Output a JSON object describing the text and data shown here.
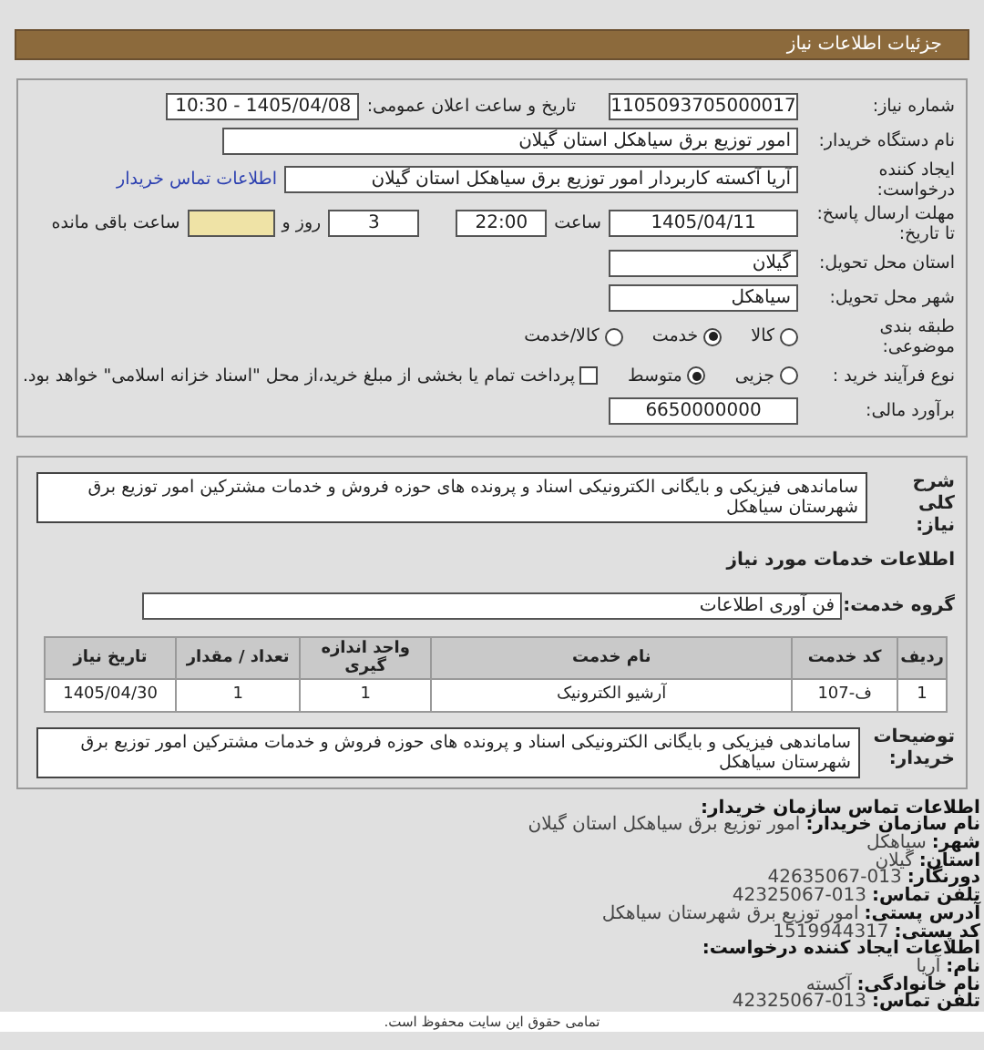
{
  "header": {
    "title": "جزئیات اطلاعات نیاز"
  },
  "need_number": {
    "label": "شماره نیاز:",
    "value": "1105093705000017"
  },
  "announce": {
    "label": "تاریخ و ساعت اعلان عمومی:",
    "value": "1405/04/08 - 10:30"
  },
  "buyer": {
    "label": "نام دستگاه خریدار:",
    "value": "امور توزیع برق سیاهکل استان گیلان"
  },
  "creator": {
    "label": "ایجاد کننده درخواست:",
    "value": "آریا آکسته کاربردار امور توزیع برق سیاهکل استان گیلان",
    "link": "اطلاعات تماس خریدار"
  },
  "deadline": {
    "label": "مهلت ارسال پاسخ: تا تاریخ:",
    "date": "1405/04/11",
    "time_label": "ساعت",
    "time": "22:00",
    "days": "3",
    "days_label": "روز و",
    "remaining_label": "ساعت باقی مانده"
  },
  "province": {
    "label": "استان محل تحویل:",
    "value": "گیلان"
  },
  "city": {
    "label": "شهر محل تحویل:",
    "value": "سیاهکل"
  },
  "category": {
    "label": "طبقه بندی موضوعی:",
    "options": [
      {
        "label": "کالا",
        "selected": false
      },
      {
        "label": "خدمت",
        "selected": true
      },
      {
        "label": "کالا/خدمت",
        "selected": false
      }
    ]
  },
  "process": {
    "label": "نوع فرآیند خرید :",
    "options": [
      {
        "label": "جزیی",
        "selected": false
      },
      {
        "label": "متوسط",
        "selected": true
      }
    ],
    "treasury": {
      "checked": false,
      "text": "پرداخت تمام یا بخشی از مبلغ خرید،از محل \"اسناد خزانه اسلامی\" خواهد بود."
    }
  },
  "estimate": {
    "label": "برآورد مالی:",
    "value": "6650000000"
  },
  "description": {
    "label": "شرح کلی نیاز:",
    "value": "ساماندهی فیزیکی و بایگانی الکترونیکی اسناد و پرونده های حوزه فروش و خدمات مشترکین امور توزیع برق شهرستان سیاهکل"
  },
  "services_heading": "اطلاعات خدمات مورد نیاز",
  "service_group": {
    "label": "گروه خدمت:",
    "value": "فن آوری اطلاعات"
  },
  "table": {
    "columns": [
      "ردیف",
      "کد خدمت",
      "نام خدمت",
      "واحد اندازه گیری",
      "تعداد / مقدار",
      "تاریخ نیاز"
    ],
    "rows": [
      [
        "1",
        "ف-107",
        "آرشیو الکترونیک",
        "1",
        "1",
        "1405/04/30"
      ]
    ]
  },
  "buyer_notes": {
    "label": "توضیحات خریدار:",
    "value": "ساماندهی فیزیکی و بایگانی الکترونیکی اسناد و پرونده های حوزه فروش و خدمات مشترکین امور توزیع برق شهرستان سیاهکل"
  },
  "contact": [
    {
      "kind": "heading",
      "label": "اطلاعات تماس سازمان خریدار:"
    },
    {
      "kind": "pair",
      "label": "نام سازمان خریدار:",
      "value": "امور توزیع برق سیاهکل استان گیلان"
    },
    {
      "kind": "pair",
      "label": "شهر:",
      "value": "سیاهکل"
    },
    {
      "kind": "pair",
      "label": "استان:",
      "value": "گیلان"
    },
    {
      "kind": "pair",
      "label": "دورنگار:",
      "value": "42635067-013"
    },
    {
      "kind": "pair",
      "label": "تلفن تماس:",
      "value": "42325067-013"
    },
    {
      "kind": "pair",
      "label": "آدرس پستی:",
      "value": "امور توزیع برق شهرستان سیاهکل"
    },
    {
      "kind": "pair",
      "label": "کد پستی:",
      "value": "1519944317"
    },
    {
      "kind": "heading",
      "label": "اطلاعات ایجاد کننده درخواست:"
    },
    {
      "kind": "pair",
      "label": "نام:",
      "value": "آریا"
    },
    {
      "kind": "pair",
      "label": "نام خانوادگی:",
      "value": "آکسته"
    },
    {
      "kind": "pair",
      "label": "تلفن تماس:",
      "value": "42325067-013"
    }
  ],
  "footer": "تمامی حقوق این سایت محفوظ است."
}
